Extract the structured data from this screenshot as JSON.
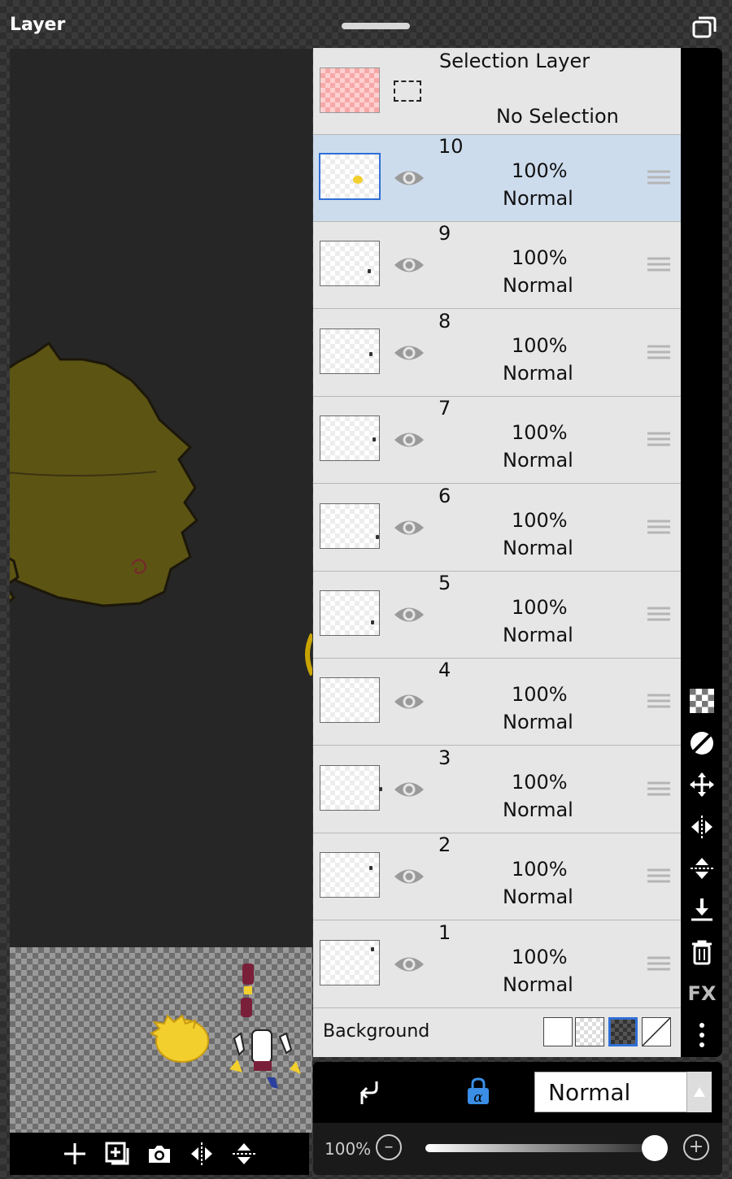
{
  "app": {
    "title": "Layer"
  },
  "selection_layer": {
    "title": "Selection Layer",
    "status": "No Selection"
  },
  "layers": [
    {
      "number": "10",
      "opacity": "100%",
      "blend": "Normal",
      "selected": true
    },
    {
      "number": "9",
      "opacity": "100%",
      "blend": "Normal",
      "selected": false
    },
    {
      "number": "8",
      "opacity": "100%",
      "blend": "Normal",
      "selected": false
    },
    {
      "number": "7",
      "opacity": "100%",
      "blend": "Normal",
      "selected": false
    },
    {
      "number": "6",
      "opacity": "100%",
      "blend": "Normal",
      "selected": false
    },
    {
      "number": "5",
      "opacity": "100%",
      "blend": "Normal",
      "selected": false
    },
    {
      "number": "4",
      "opacity": "100%",
      "blend": "Normal",
      "selected": false
    },
    {
      "number": "3",
      "opacity": "100%",
      "blend": "Normal",
      "selected": false
    },
    {
      "number": "2",
      "opacity": "100%",
      "blend": "Normal",
      "selected": false
    },
    {
      "number": "1",
      "opacity": "100%",
      "blend": "Normal",
      "selected": false
    }
  ],
  "background": {
    "label": "Background",
    "options": [
      "white",
      "transparent",
      "dark-checker",
      "none"
    ],
    "selected_index": 2
  },
  "side_tools": [
    "transparency-icon",
    "clear-icon",
    "move-icon",
    "flip-horizontal-icon",
    "flip-vertical-icon",
    "merge-down-icon",
    "trash-icon",
    "FX",
    "more-icon"
  ],
  "bottom_tools": [
    "add-layer-icon",
    "duplicate-layer-icon",
    "camera-icon",
    "flip-horizontal-icon",
    "flip-vertical-icon"
  ],
  "blend_mode": {
    "value": "Normal"
  },
  "opacity": {
    "label": "100%",
    "value": 1.0
  },
  "colors": {
    "panel": "#e6e6e6",
    "selected_row": "#cddced",
    "accent": "#2f6fd6",
    "alpha_lock": "#3a8ee6"
  }
}
